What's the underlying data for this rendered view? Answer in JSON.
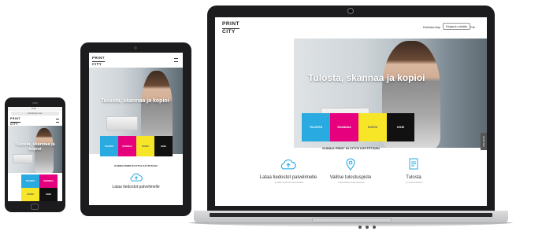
{
  "brand": {
    "line1": "PRINT",
    "line2": "CITY"
  },
  "hero": {
    "title": "Tulosta, skannaa ja kopioi"
  },
  "colors": {
    "cyan": "#29abe2",
    "magenta": "#e6007e",
    "yellow": "#f7e628",
    "black": "#111111",
    "device": "#1c1c1e",
    "laptop_body": "#c8c9cb"
  },
  "tiles": [
    {
      "label": "TULOSTA",
      "color": "#29abe2",
      "text_color": "#ffffff"
    },
    {
      "label": "SKANNAA",
      "color": "#e6007e",
      "text_color": "#ffffff"
    },
    {
      "label": "KOPIOI",
      "color": "#f7e628",
      "text_color": "#555555"
    },
    {
      "label": "OHJE",
      "color": "#111111",
      "text_color": "#ffffff"
    }
  ],
  "laptop": {
    "nav": {
      "link": "Rekisteröidy",
      "login_button": "Kirjaudu sisään",
      "language": "FI"
    },
    "section_title": "KUINKA PRINT IN CITYÄ KÄYTETÄÄN",
    "side_tab": "PALAUTE",
    "steps": [
      {
        "icon": "cloud-upload-icon",
        "label": "Lataa tiedostot palvelimelle",
        "sub": "...ja valitse tiedostot tulostettavaksi"
      },
      {
        "icon": "location-pin-icon",
        "label": "Valitse tulostuspiste",
        "sub": "...mistä haluat noutaa tulosteesi"
      },
      {
        "icon": "document-icon",
        "label": "Tulosta",
        "sub": "...ja nouda tulosteesi"
      }
    ]
  },
  "tablet": {
    "section_title": "KUINKA PRINT IN CITYÄ KÄYTETÄÄN",
    "step_label": "Lataa tiedostot palvelimelle"
  },
  "phone": {
    "status_time": "9:41",
    "url": "printincity.com"
  }
}
